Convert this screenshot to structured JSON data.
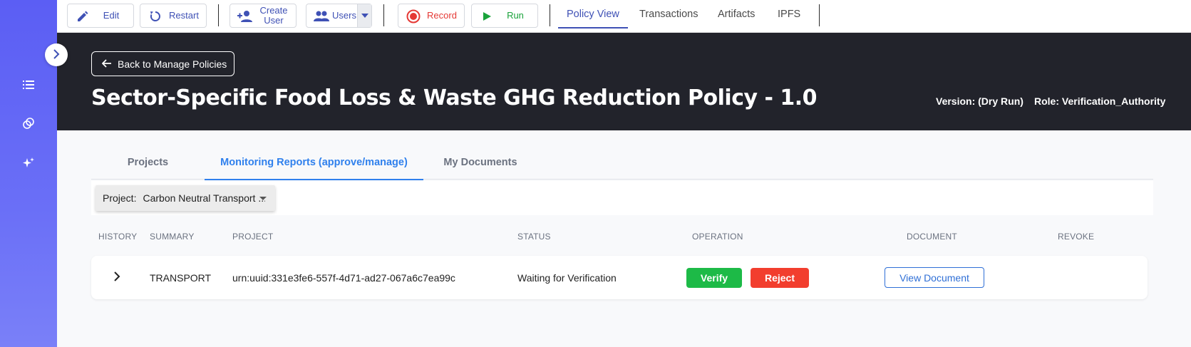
{
  "sidebar": {
    "toggle_icon": "chevron-right-icon",
    "items": [
      {
        "icon": "list-icon"
      },
      {
        "icon": "tokens-icon"
      },
      {
        "icon": "sparkle-icon"
      }
    ],
    "colors": {
      "top": "#5b5ef4",
      "bottom": "#7a80f8"
    }
  },
  "toolbar": {
    "edit": "Edit",
    "restart": "Restart",
    "create_user_line1": "Create",
    "create_user_line2": "User",
    "users": "Users",
    "record": "Record",
    "run": "Run",
    "tabs": [
      "Policy View",
      "Transactions",
      "Artifacts",
      "IPFS"
    ],
    "active_tab": "Policy View",
    "colors": {
      "primary": "#3f51b5",
      "record": "#e53935",
      "run": "#1aa33b"
    }
  },
  "header": {
    "back_label": "Back to Manage Policies",
    "title": "Sector-Specific Food Loss & Waste GHG Reduction Policy - 1.0",
    "version": "Version: (Dry Run)",
    "role": "Role: Verification_Authority",
    "background": "#22232b"
  },
  "content": {
    "tabs": [
      "Projects",
      "Monitoring Reports (approve/manage)",
      "My Documents"
    ],
    "active_tab": "Monitoring Reports (approve/manage)",
    "filter": {
      "label": "Project:",
      "value": "Carbon Neutral Transport ..."
    },
    "columns": [
      "HISTORY",
      "SUMMARY",
      "PROJECT",
      "STATUS",
      "OPERATION",
      "DOCUMENT",
      "REVOKE"
    ],
    "rows": [
      {
        "summary": "TRANSPORT",
        "project": "urn:uuid:331e3fe6-557f-4d71-ad27-067a6c7ea99c",
        "status": "Waiting for Verification",
        "verify": "Verify",
        "reject": "Reject",
        "document": "View Document"
      }
    ],
    "colors": {
      "accent": "#2f80ed",
      "verify": "#1dba47",
      "reject": "#f23e2e"
    }
  }
}
